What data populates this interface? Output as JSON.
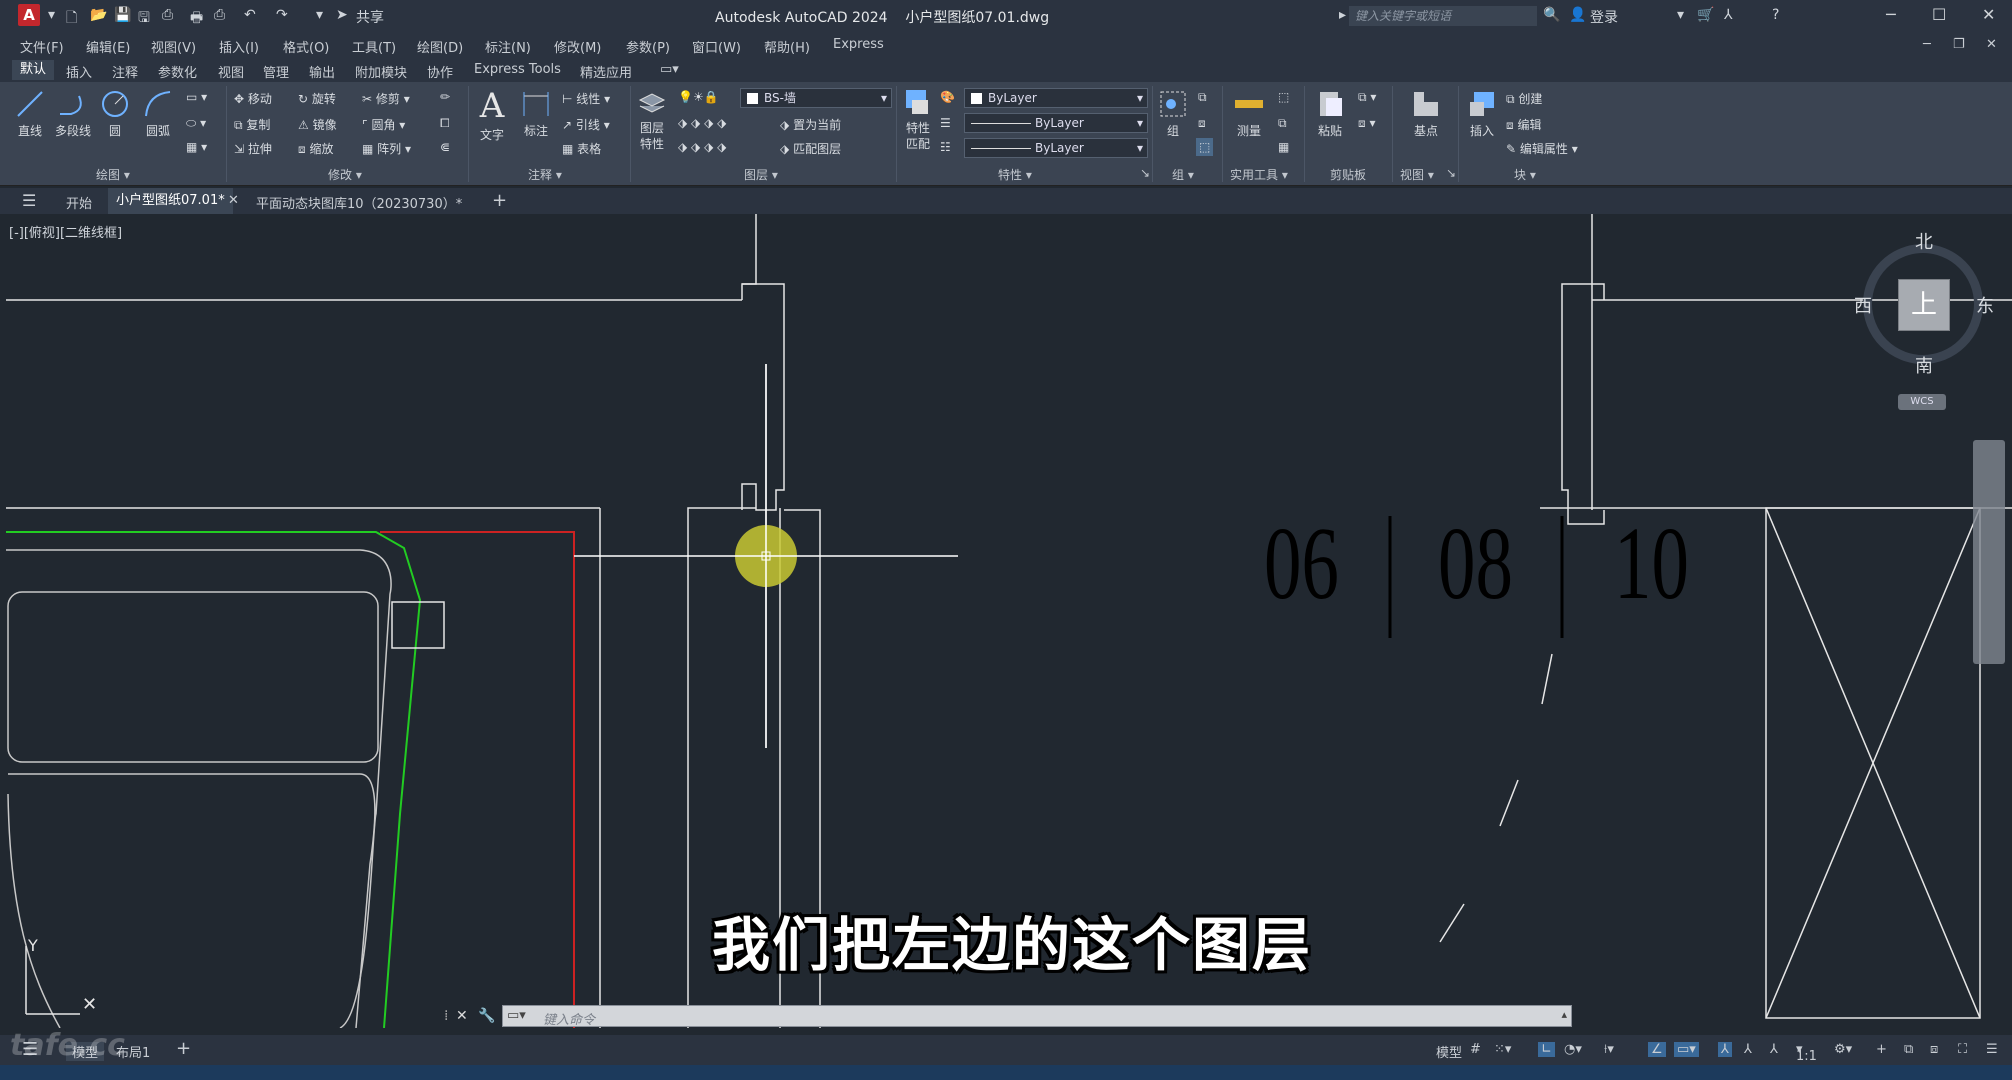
{
  "app": {
    "logo": "A",
    "title": "Autodesk AutoCAD 2024",
    "file": "小户型图纸07.01.dwg",
    "share": "共享",
    "search_placeholder": "键入关键字或短语",
    "login": "登录"
  },
  "menus": [
    "文件(F)",
    "编辑(E)",
    "视图(V)",
    "插入(I)",
    "格式(O)",
    "工具(T)",
    "绘图(D)",
    "标注(N)",
    "修改(M)",
    "参数(P)",
    "窗口(W)",
    "帮助(H)",
    "Express"
  ],
  "ribbon_tabs": [
    "默认",
    "插入",
    "注释",
    "参数化",
    "视图",
    "管理",
    "输出",
    "附加模块",
    "协作",
    "Express Tools",
    "精选应用"
  ],
  "ribbon": {
    "draw": {
      "line": "直线",
      "polyline": "多段线",
      "circle": "圆",
      "arc": "圆弧",
      "title": "绘图"
    },
    "modify": {
      "move": "移动",
      "rotate": "旋转",
      "trim": "修剪",
      "copy": "复制",
      "mirror": "镜像",
      "fillet": "圆角",
      "stretch": "拉伸",
      "scale": "缩放",
      "array": "阵列",
      "title": "修改"
    },
    "annotation": {
      "text": "文字",
      "dim": "标注",
      "linear": "线性",
      "leader": "引线",
      "table": "表格",
      "title": "注释"
    },
    "layers": {
      "props": "图层特性",
      "current_layer": "BS-墙",
      "set_current": "置为当前",
      "match_layer": "匹配图层",
      "title": "图层"
    },
    "properties": {
      "match": "特性匹配",
      "color": "ByLayer",
      "linetype": "ByLayer",
      "lineweight": "ByLayer",
      "title": "特性"
    },
    "groups": {
      "group": "组",
      "title": "组"
    },
    "utilities": {
      "measure": "测量",
      "title": "实用工具"
    },
    "clipboard": {
      "paste": "粘贴",
      "title": "剪贴板"
    },
    "view": {
      "base": "基点",
      "title": "视图"
    },
    "block": {
      "insert": "插入",
      "create": "创建",
      "edit": "编辑",
      "edit_attr": "编辑属性",
      "title": "块"
    }
  },
  "doc_tabs": [
    "开始",
    "小户型图纸07.01*",
    "平面动态块图库10（20230730）*"
  ],
  "view_label": "[-][俯视][二维线框]",
  "viewcube": {
    "north": "北",
    "south": "南",
    "west": "西",
    "east": "东",
    "face": "上",
    "wcs": "WCS"
  },
  "canvas_text": [
    "06",
    "08",
    "10"
  ],
  "subtitle": "我们把左边的这个图层",
  "command_placeholder": "键入命令",
  "status": {
    "model": "模型",
    "layout": "布局1",
    "model_btn": "模型",
    "scale": "1:1"
  },
  "watermark": "tafe.cc",
  "colors": {
    "background": "#212830",
    "green_line": "#22cc22",
    "red_line": "#cc2222",
    "cursor": "#c8c832"
  }
}
